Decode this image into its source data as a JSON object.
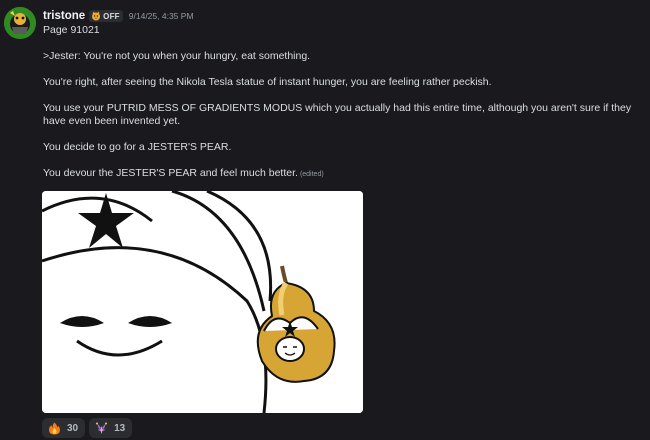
{
  "message": {
    "username": "tristone",
    "tag": "OFF",
    "timestamp": "9/14/25, 4:35 PM",
    "lines": [
      "Page 91021",
      ">Jester: You're not you when your hungry, eat something.",
      "You're right, after seeing the Nikola Tesla statue of instant hunger, you are feeling rather peckish.",
      "You use your PUTRID MESS OF GRADIENTS MODUS which you actually had this entire time, although you aren't sure if they have even been invented yet.",
      "You decide to go for a JESTER'S PEAR.",
      "You devour the JESTER'S PEAR and feel much better."
    ],
    "edited_label": "(edited)",
    "attachment_icon": "pear-jester-image"
  },
  "reactions": [
    {
      "emoji": "fire-emoji",
      "count": "30"
    },
    {
      "emoji": "jester-sparkle-emoji",
      "count": "13"
    }
  ],
  "colors": {
    "background": "#1a1a1e",
    "username": "#f2f3f5",
    "text": "#dbdee1",
    "muted": "#949ba4",
    "pill": "#2b2d31"
  }
}
